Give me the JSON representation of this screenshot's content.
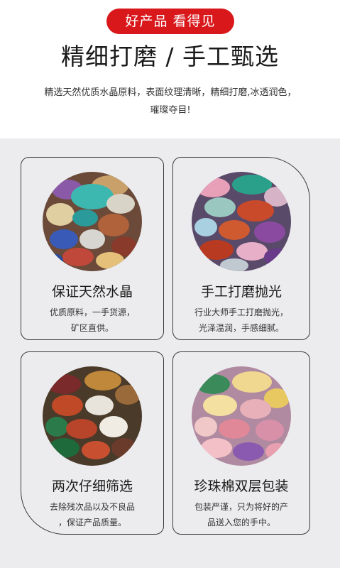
{
  "header": {
    "badge": "好产品 看得见",
    "headline": "精细打磨 / 手工甄选",
    "description": "精选天然优质水晶原料，表面纹理清晰，精细打磨,冰透润色，璀璨夺目!"
  },
  "cards": [
    {
      "title": "保证天然水晶",
      "line1": "优质原料，一手货源，",
      "line2": "矿区直供。"
    },
    {
      "title": "手工打磨抛光",
      "line1": "行业大师手工打磨抛光，",
      "line2": "光泽温润，手感细腻。"
    },
    {
      "title": "两次仔细筛选",
      "line1": "去除残次品以及不良品",
      "line2": "，保证产品质量。"
    },
    {
      "title": "珍珠棉双层包装",
      "line1": "包装严谨，只为将好的产",
      "line2": "品送入您的手中。"
    }
  ],
  "colors": {
    "badge_red": "#d9181c",
    "panel_gray": "#ececee",
    "card_border": "#3a3a3a"
  }
}
